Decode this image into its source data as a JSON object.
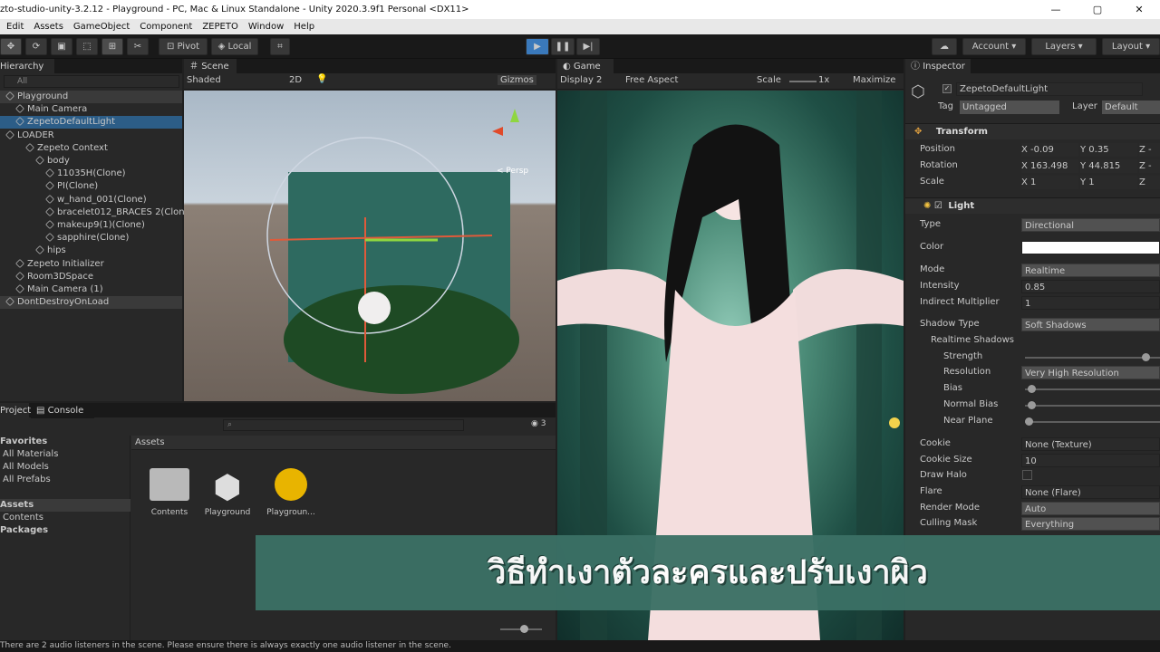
{
  "window": {
    "title": "zto-studio-unity-3.2.12 - Playground - PC, Mac & Linux Standalone - Unity 2020.3.9f1 Personal <DX11>",
    "min": "—",
    "max": "▢",
    "close": "✕"
  },
  "menu": [
    "Edit",
    "Assets",
    "GameObject",
    "Component",
    "ZEPETO",
    "Window",
    "Help"
  ],
  "toolbar": {
    "pivot": "Pivot",
    "local": "Local",
    "account": "Account",
    "layers": "Layers",
    "layout": "Layout"
  },
  "hierarchy": {
    "tab": "Hierarchy",
    "search": "All",
    "items": [
      {
        "label": "Playground",
        "indent": 0,
        "style": "hdr"
      },
      {
        "label": "Main Camera",
        "indent": 1
      },
      {
        "label": "ZepetoDefaultLight",
        "indent": 1,
        "style": "sel"
      },
      {
        "label": "LOADER",
        "indent": 0
      },
      {
        "label": "Zepeto Context",
        "indent": 2
      },
      {
        "label": "body",
        "indent": 3
      },
      {
        "label": "11035H(Clone)",
        "indent": 4
      },
      {
        "label": "PI(Clone)",
        "indent": 4
      },
      {
        "label": "w_hand_001(Clone)",
        "indent": 4
      },
      {
        "label": "bracelet012_BRACES 2(Clone)",
        "indent": 4
      },
      {
        "label": "makeup9(1)(Clone)",
        "indent": 4
      },
      {
        "label": "sapphire(Clone)",
        "indent": 4
      },
      {
        "label": "hips",
        "indent": 3
      },
      {
        "label": "Zepeto Initializer",
        "indent": 1
      },
      {
        "label": "Room3DSpace",
        "indent": 1
      },
      {
        "label": "Main Camera (1)",
        "indent": 1
      },
      {
        "label": "DontDestroyOnLoad",
        "indent": 0,
        "style": "hdr"
      }
    ]
  },
  "scene": {
    "tab": "Scene",
    "shading": "Shaded",
    "mode2d": "2D",
    "gizmos": "Gizmos",
    "persp": "< Persp"
  },
  "game": {
    "tab": "Game",
    "display": "Display 2",
    "aspect": "Free Aspect",
    "scale": "Scale",
    "scale_val": "1x",
    "maximize": "Maximize"
  },
  "project": {
    "tab": "Project",
    "console": "Console",
    "count": "3",
    "favorites": "Favorites",
    "fav_items": [
      "All Materials",
      "All Models",
      "All Prefabs"
    ],
    "assets_label": "Assets",
    "asset_tree": [
      "Assets",
      "Contents",
      "Packages"
    ],
    "asset_items": [
      "Contents",
      "Playground",
      "Playgroun..."
    ]
  },
  "inspector": {
    "tab": "Inspector",
    "object": "ZepetoDefaultLight",
    "tag_label": "Tag",
    "tag": "Untagged",
    "layer_label": "Layer",
    "layer": "Default",
    "transform": {
      "title": "Transform",
      "rows": [
        {
          "label": "Position",
          "x": "-0.09",
          "y": "0.35",
          "z": "-"
        },
        {
          "label": "Rotation",
          "x": "163.498",
          "y": "44.815",
          "z": "-"
        },
        {
          "label": "Scale",
          "x": "1",
          "y": "1",
          "z": ""
        }
      ]
    },
    "light": {
      "title": "Light",
      "fields": [
        {
          "label": "Type",
          "value": "Directional",
          "kind": "dd"
        },
        {
          "label": "Color",
          "value": "",
          "kind": "color"
        },
        {
          "label": "Mode",
          "value": "Realtime",
          "kind": "dd"
        },
        {
          "label": "Intensity",
          "value": "0.85",
          "kind": "val"
        },
        {
          "label": "Indirect Multiplier",
          "value": "1",
          "kind": "val"
        },
        {
          "label": "Shadow Type",
          "value": "Soft Shadows",
          "kind": "dd"
        },
        {
          "label": "Realtime Shadows",
          "value": "",
          "kind": "sub"
        },
        {
          "label": "Strength",
          "value": "",
          "kind": "slider",
          "level": 0.92
        },
        {
          "label": "Resolution",
          "value": "Very High Resolution",
          "kind": "dd"
        },
        {
          "label": "Bias",
          "value": "",
          "kind": "slider",
          "level": 0.02
        },
        {
          "label": "Normal Bias",
          "value": "",
          "kind": "slider",
          "level": 0.02
        },
        {
          "label": "Near Plane",
          "value": "",
          "kind": "slider",
          "level": 0.0
        },
        {
          "label": "Cookie",
          "value": "None (Texture)",
          "kind": "val"
        },
        {
          "label": "Cookie Size",
          "value": "10",
          "kind": "val"
        },
        {
          "label": "Draw Halo",
          "value": "",
          "kind": "check"
        },
        {
          "label": "Flare",
          "value": "None (Flare)",
          "kind": "val"
        },
        {
          "label": "Render Mode",
          "value": "Auto",
          "kind": "dd"
        },
        {
          "label": "Culling Mask",
          "value": "Everything",
          "kind": "dd"
        }
      ]
    }
  },
  "banner": "วิธีทำเงาตัวละครและปรับเงาผิว",
  "status": "There are 2 audio listeners in the scene. Please ensure there is always exactly one audio listener in the scene."
}
